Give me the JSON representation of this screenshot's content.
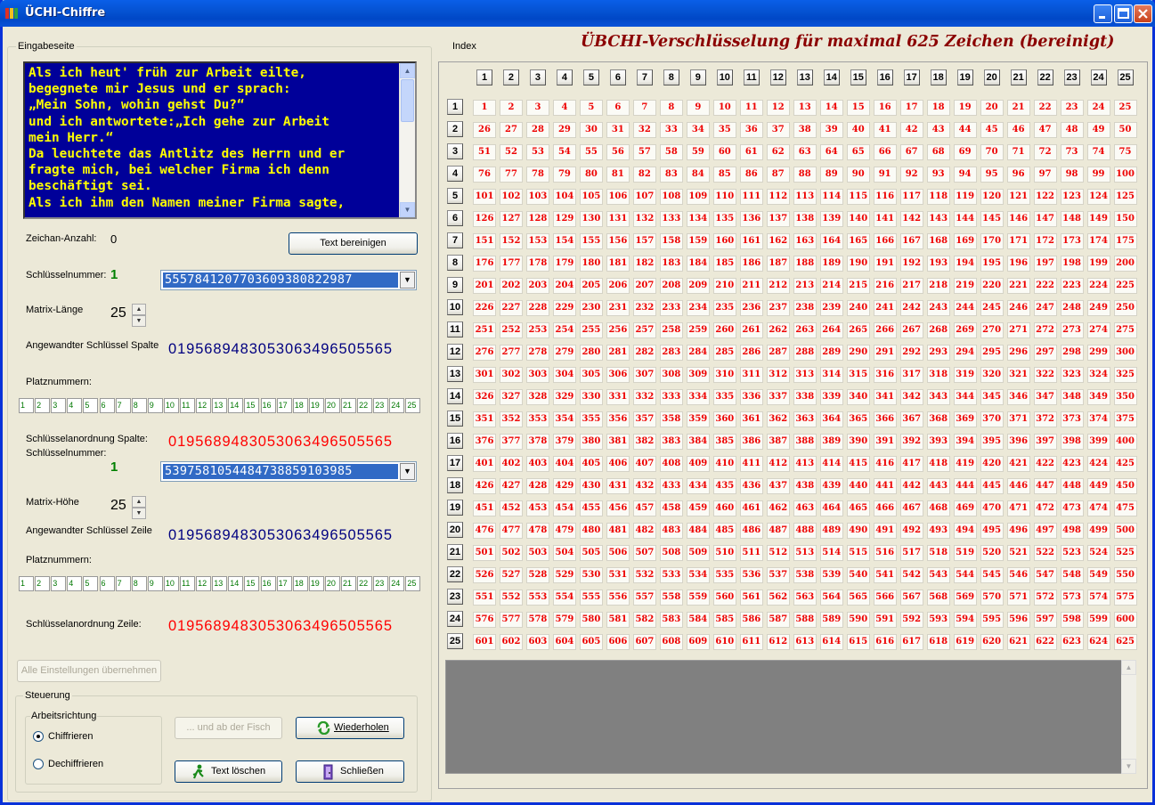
{
  "window": {
    "title": "ÜCHI-Chiffre"
  },
  "eingabe": {
    "group_label": "Eingabeseite",
    "text": "Als ich heut' früh zur Arbeit eilte,\nbegegnete mir Jesus und er sprach:\n„Mein Sohn, wohin gehst Du?“\nund ich antwortete:„Ich gehe zur Arbeit\nmein Herr.“\nDa leuchtete das Antlitz des Herrn und er\nfragte mich, bei welcher Firma ich denn\nbeschäftigt sei.\nAls ich ihm den Namen meiner Firma sagte,"
  },
  "form": {
    "count_label": "Zeichan-Anzahl:",
    "count_value": "0",
    "clean_button": "Text bereinigen",
    "key1_label": "Schlüsselnummer:",
    "key1_num": "1",
    "key1_value": "5557841207703609380822987",
    "matrix_len_label": "Matrix-Länge",
    "matrix_len_value": "25",
    "applied_col_label": "Angewandter Schlüssel Spalte",
    "applied_col_value": "0195689483053063496505565",
    "platz_label1": "Platznummern:",
    "arrangement_col_label": "Schlüsselanordnung Spalte:",
    "arrangement_col_value": "0195689483053063496505565",
    "key2_label": "Schlüsselnummer:",
    "key2_num": "1",
    "key2_value": "5397581054484738859103985",
    "matrix_height_label": "Matrix-Höhe",
    "matrix_height_value": "25",
    "applied_row_label": "Angewandter Schlüssel Zeile",
    "applied_row_value": "0195689483053063496505565",
    "platz_label2": "Platznummern:",
    "arrangement_row_label": "Schlüsselanordnung Zeile:",
    "arrangement_row_value": "0195689483053063496505565",
    "apply_all_button": "Alle Einstellungen übernehmen",
    "platznummern": [
      "1",
      "2",
      "3",
      "4",
      "5",
      "6",
      "7",
      "8",
      "9",
      "10",
      "11",
      "12",
      "13",
      "14",
      "15",
      "16",
      "17",
      "18",
      "19",
      "20",
      "21",
      "22",
      "23",
      "24",
      "25"
    ]
  },
  "steuerung": {
    "group_label": "Steuerung",
    "direction_label": "Arbeitsrichtung",
    "encrypt_label": "Chiffrieren",
    "decrypt_label": "Dechiffrieren",
    "encrypt_selected": true,
    "fisch_button": "... und ab der Fisch",
    "repeat_button": "Wiederholen",
    "clear_button": "Text löschen",
    "close_button": "Schließen"
  },
  "grid": {
    "index_label": "Index",
    "title": "ÜBCHI-Verschlüsselung für maximal 625 Zeichen (bereinigt)",
    "size": 25
  },
  "colors": {
    "text_bg": "#000099",
    "text_fg": "#ffff00",
    "key_blue": "#000080",
    "key_red": "#ff0000",
    "cell_red": "#ee0000",
    "title_red": "#8b0000"
  }
}
